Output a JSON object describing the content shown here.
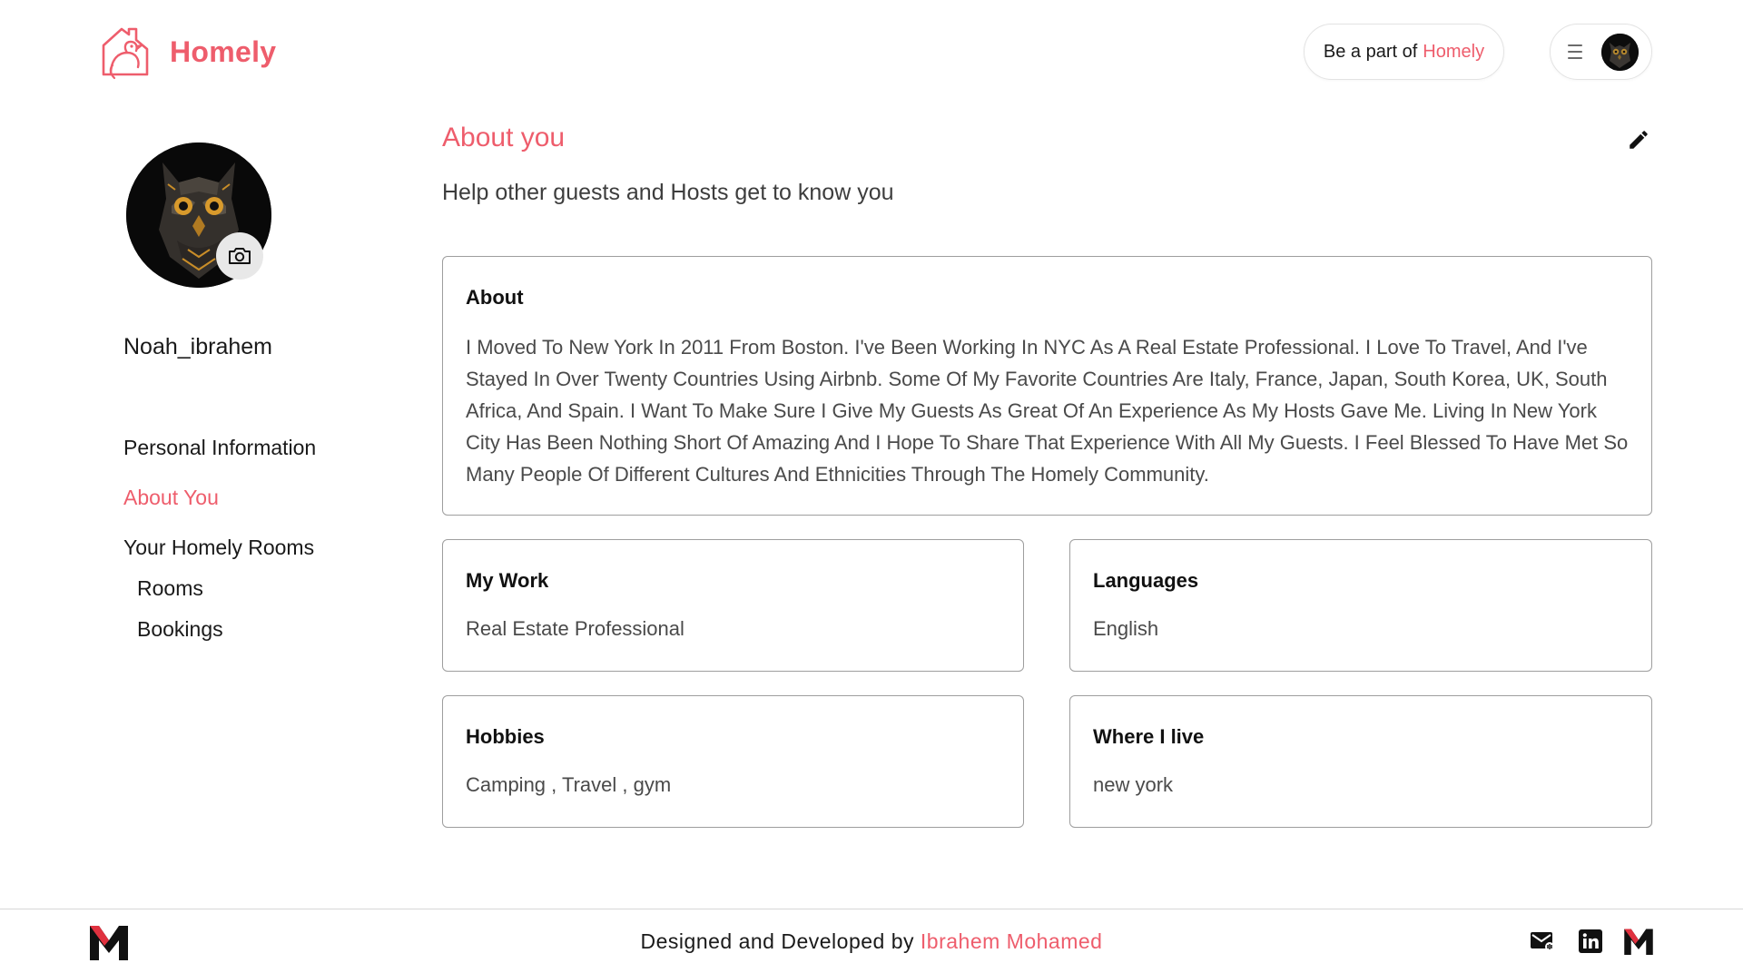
{
  "header": {
    "brand_name": "Homely",
    "host_cta_prefix": "Be a part of",
    "host_cta_brand": "Homely"
  },
  "sidebar": {
    "username": "Noah_ibrahem",
    "nav": [
      {
        "label": "Personal Information",
        "active": false
      },
      {
        "label": "About You",
        "active": true
      },
      {
        "label": "Your Homely Rooms",
        "active": false
      },
      {
        "label": "Rooms",
        "active": false
      },
      {
        "label": "Bookings",
        "active": false
      }
    ]
  },
  "main": {
    "title": "About you",
    "subtitle": "Help other guests and Hosts get to know you",
    "about_card": {
      "title": "About",
      "text": "I Moved To New York In 2011 From Boston. I've Been Working In NYC As A Real Estate Professional. I Love To Travel, And I've Stayed In Over Twenty Countries Using Airbnb. Some Of My Favorite Countries Are Italy, France, Japan, South Korea, UK, South Africa, And Spain. I Want To Make Sure I Give My Guests As Great Of An Experience As My Hosts Gave Me. Living In New York City Has Been Nothing Short Of Amazing And I Hope To Share That Experience With All My Guests. I Feel Blessed To Have Met So Many People Of Different Cultures And Ethnicities Through The Homely Community."
    },
    "work_card": {
      "title": "My Work",
      "value": "Real Estate Professional"
    },
    "languages_card": {
      "title": "Languages",
      "value": "English"
    },
    "hobbies_card": {
      "title": "Hobbies",
      "value": "Camping , Travel , gym"
    },
    "location_card": {
      "title": "Where I live",
      "value": "new york"
    }
  },
  "footer": {
    "credit_prefix": "Designed and Developed by",
    "credit_name": "Ibrahem Mohamed"
  },
  "icons": {
    "logo": "house-bird-icon",
    "menu": "hamburger-icon",
    "camera": "camera-icon",
    "edit": "pencil-icon",
    "email": "email-icon",
    "linkedin": "linkedin-icon",
    "brand_m": "m-logo-icon"
  },
  "colors": {
    "accent": "#ee5d6c",
    "text": "#1a1a1a",
    "muted_text": "#4a4a4a",
    "card_border": "#9e9e9e"
  }
}
